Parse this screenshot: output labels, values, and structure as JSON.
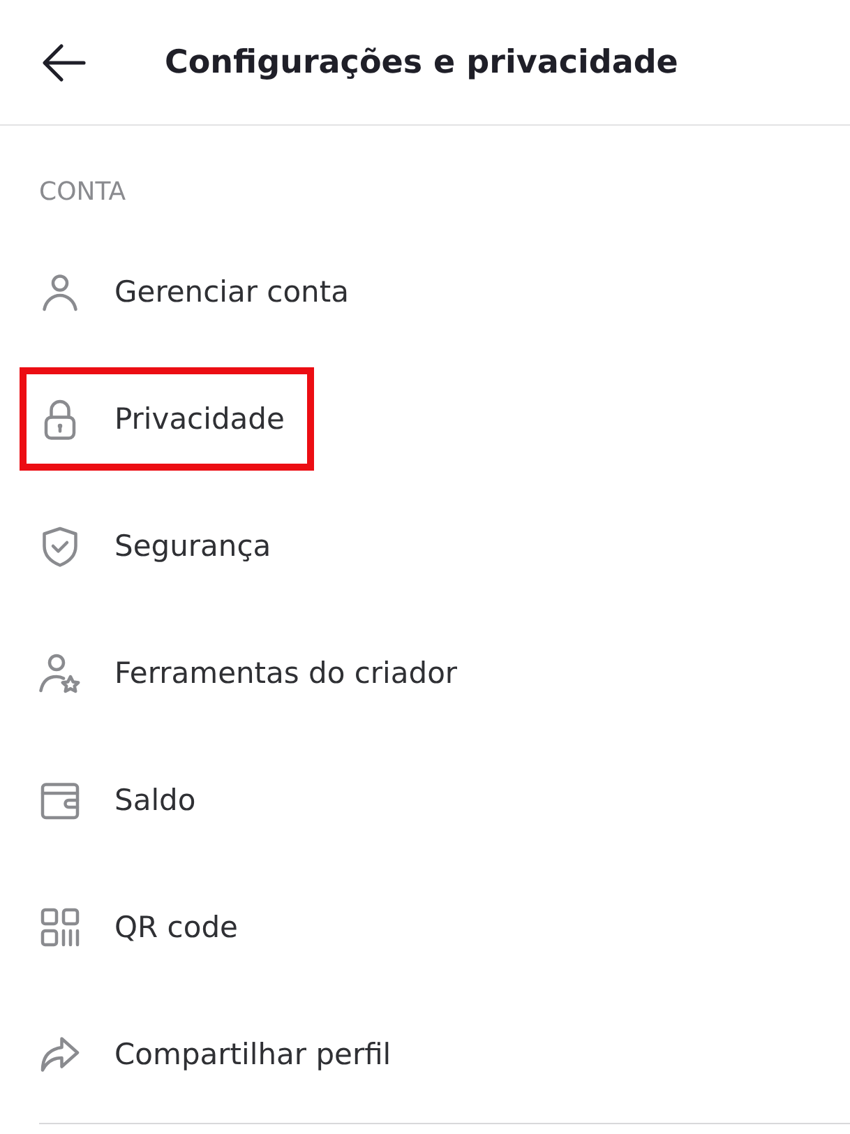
{
  "header": {
    "title": "Configurações e privacidade"
  },
  "section": {
    "label": "CONTA"
  },
  "items": [
    {
      "kind": "person",
      "label": "Gerenciar conta",
      "highlighted": false
    },
    {
      "kind": "lock",
      "label": "Privacidade",
      "highlighted": true
    },
    {
      "kind": "shield",
      "label": "Segurança",
      "highlighted": false
    },
    {
      "kind": "creator",
      "label": "Ferramentas do criador",
      "highlighted": false
    },
    {
      "kind": "wallet",
      "label": "Saldo",
      "highlighted": false
    },
    {
      "kind": "qr",
      "label": "QR code",
      "highlighted": false
    },
    {
      "kind": "share",
      "label": "Compartilhar perfil",
      "highlighted": false
    }
  ]
}
